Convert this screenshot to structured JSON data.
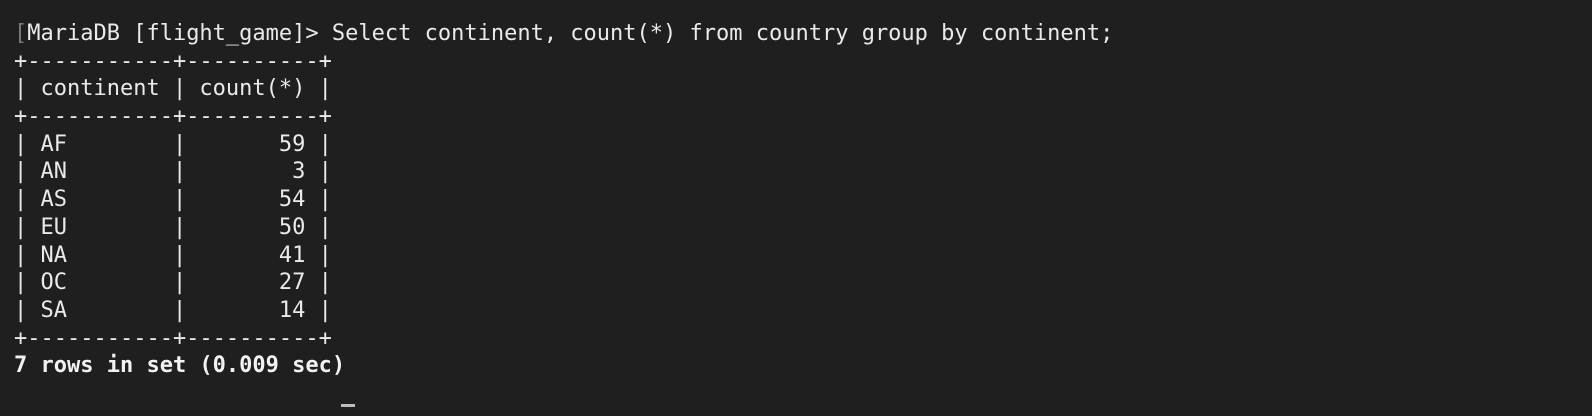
{
  "terminal": {
    "prompt": "MariaDB [flight_game]> ",
    "command": "Select continent, count(*) from country group by continent;",
    "border": "+-----------+----------+",
    "header_row": "| continent | count(*) |",
    "rows": [
      "| AF        |       59 |",
      "| AN        |        3 |",
      "| AS        |       54 |",
      "| EU        |       50 |",
      "| NA        |       41 |",
      "| OC        |       27 |",
      "| SA        |       14 |"
    ],
    "footer": "7 rows in set (0.009 sec)"
  },
  "result": {
    "columns": [
      "continent",
      "count(*)"
    ],
    "rows": [
      [
        "AF",
        59
      ],
      [
        "AN",
        3
      ],
      [
        "AS",
        54
      ],
      [
        "EU",
        50
      ],
      [
        "NA",
        41
      ],
      [
        "OC",
        27
      ],
      [
        "SA",
        14
      ]
    ]
  }
}
